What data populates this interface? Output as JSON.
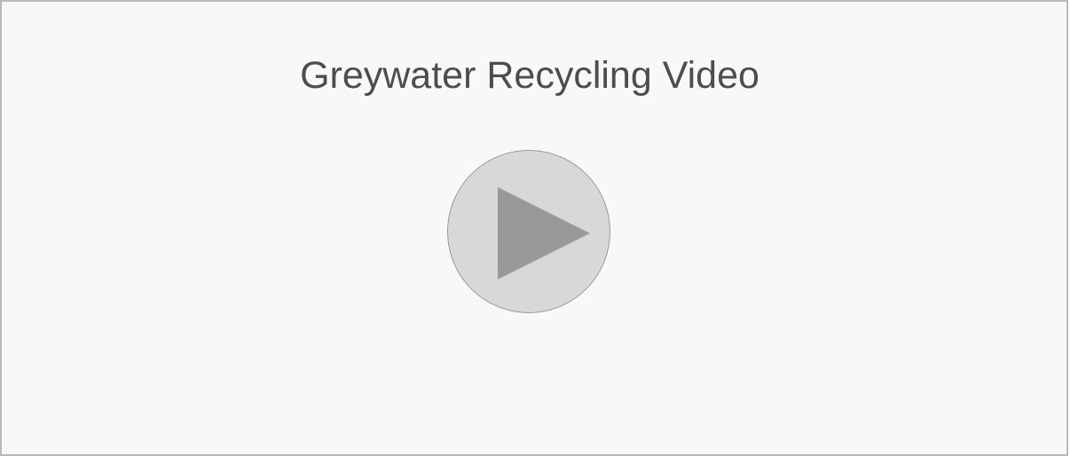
{
  "video": {
    "title": "Greywater Recycling Video",
    "play_icon": "play-icon"
  },
  "colors": {
    "background": "#f8f8f8",
    "border": "#b9b9b9",
    "title_text": "#4d4d4d",
    "play_circle": "#d8d8d8",
    "play_triangle": "#999999"
  }
}
